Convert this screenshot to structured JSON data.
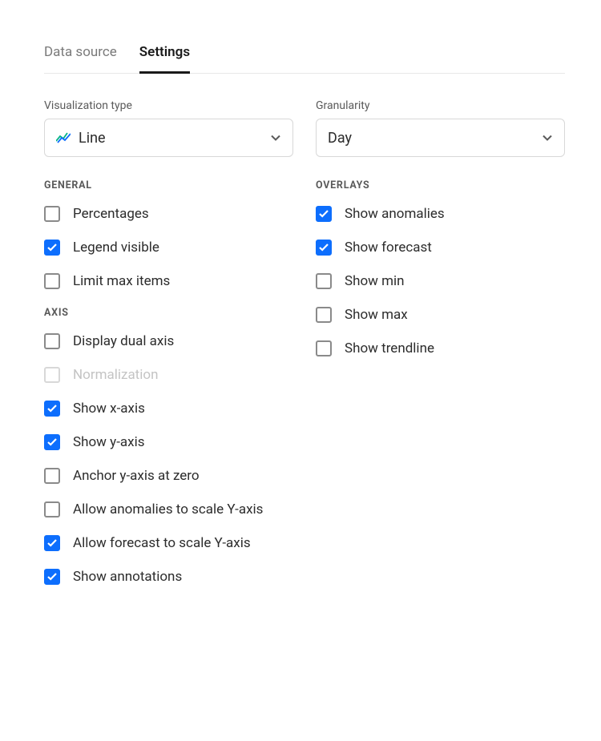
{
  "tabs": {
    "dataSource": "Data source",
    "settings": "Settings"
  },
  "labels": {
    "visualizationType": "Visualization type",
    "granularity": "Granularity"
  },
  "selects": {
    "visualizationType": "Line",
    "granularity": "Day"
  },
  "sections": {
    "general": "GENERAL",
    "axis": "AXIS",
    "overlays": "OVERLAYS"
  },
  "general": {
    "percentages": "Percentages",
    "legendVisible": "Legend visible",
    "limitMaxItems": "Limit max items"
  },
  "axis": {
    "displayDualAxis": "Display dual axis",
    "normalization": "Normalization",
    "showXAxis": "Show x-axis",
    "showYAxis": "Show y-axis",
    "anchorYZero": "Anchor y-axis at zero",
    "allowAnomaliesScale": "Allow anomalies to scale Y-axis",
    "allowForecastScale": "Allow forecast to scale Y-axis",
    "showAnnotations": "Show annotations"
  },
  "overlays": {
    "showAnomalies": "Show anomalies",
    "showForecast": "Show forecast",
    "showMin": "Show min",
    "showMax": "Show max",
    "showTrendline": "Show trendline"
  }
}
